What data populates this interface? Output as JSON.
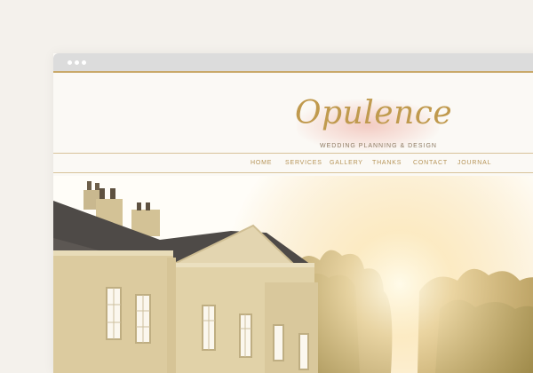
{
  "brand": {
    "name": "Opulence",
    "tagline": "WEDDING PLANNING & DESIGN"
  },
  "nav": {
    "items": [
      "HOME",
      "SERVICES",
      "GALLERY",
      "THANKS",
      "CONTACT",
      "JOURNAL"
    ]
  },
  "colors": {
    "accent_gold": "#c9a96a",
    "nav_text": "#b69458",
    "logo_gold": "#c09a4e",
    "blush_wash": "#f0bcb2"
  },
  "hero": {
    "alt": "photo-of-country-manor-house-at-sunset"
  }
}
